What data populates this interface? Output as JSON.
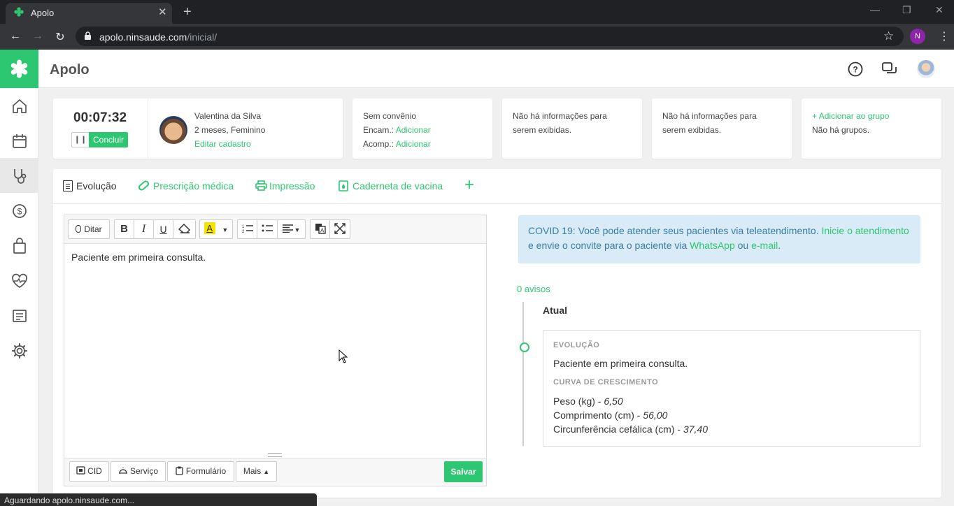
{
  "browser": {
    "tab_title": "Apolo",
    "url_host": "apolo.ninsaude.com",
    "url_path": "/inicial/",
    "profile_initial": "N",
    "status_text": "Aguardando apolo.ninsaude.com..."
  },
  "app": {
    "title": "Apolo",
    "brand_color": "#2ec771"
  },
  "patient": {
    "timer": "00:07:32",
    "conclude_label": "Concluir",
    "name": "Valentina da Silva",
    "age_sex": "2 meses, Feminino",
    "edit_link": "Editar cadastro",
    "insurance": "Sem convênio",
    "encam_label": "Encam.:",
    "encam_link": "Adicionar",
    "acomp_label": "Acomp.:",
    "acomp_link": "Adicionar",
    "info1_line1": "Não há informações para",
    "info1_line2": "serem exibidas.",
    "info2_line1": "Não há informações para",
    "info2_line2": "serem exibidas.",
    "group_add": "Adicionar ao grupo",
    "group_none": "Não há grupos."
  },
  "tabs": [
    {
      "label": "Evolução",
      "icon": "document-icon",
      "active": true
    },
    {
      "label": "Prescrição médica",
      "icon": "pill-icon"
    },
    {
      "label": "Impressão",
      "icon": "printer-icon"
    },
    {
      "label": "Caderneta de vacina",
      "icon": "vaccine-icon"
    }
  ],
  "editor": {
    "dictate_label": "Ditar",
    "content": "Paciente em primeira consulta.",
    "footer": {
      "cid": "CID",
      "servico": "Serviço",
      "formulario": "Formulário",
      "mais": "Mais",
      "salvar": "Salvar"
    }
  },
  "covid": {
    "text1": "COVID 19: Você pode atender seus pacientes via teleatendimento.",
    "link1a": "Inicie o",
    "link1b": "atendimento",
    "text2": "e envie o convite para o paciente via",
    "link2": "WhatsApp",
    "text3": "ou",
    "link3": "e-mail",
    "text4": "."
  },
  "timeline": {
    "avisos": "0 avisos",
    "current_label": "Atual",
    "section1": "EVOLUÇÃO",
    "section1_text": "Paciente em primeira consulta.",
    "section2": "CURVA DE CRESCIMENTO",
    "peso_label": "Peso (kg) -",
    "peso_value": "6,50",
    "comprimento_label": "Comprimento (cm) -",
    "comprimento_value": "56,00",
    "circ_label": "Circunferência cefálica (cm) -",
    "circ_value": "37,40"
  }
}
